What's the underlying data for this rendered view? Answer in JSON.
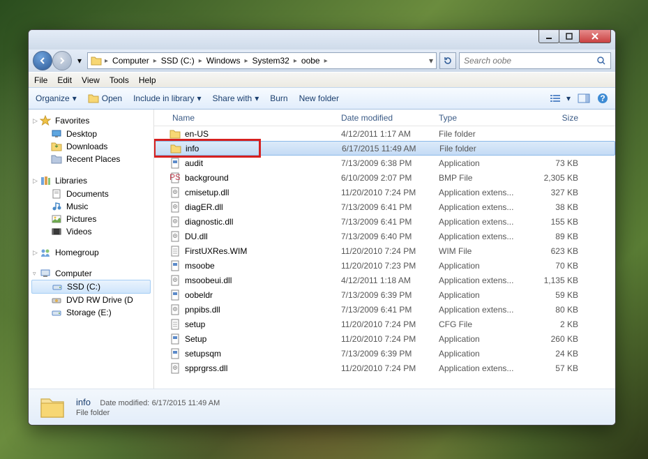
{
  "breadcrumbs": [
    "Computer",
    "SSD (C:)",
    "Windows",
    "System32",
    "oobe"
  ],
  "search": {
    "placeholder": "Search oobe"
  },
  "menu": {
    "file": "File",
    "edit": "Edit",
    "view": "View",
    "tools": "Tools",
    "help": "Help"
  },
  "toolbar": {
    "organize": "Organize",
    "open": "Open",
    "include": "Include in library",
    "share": "Share with",
    "burn": "Burn",
    "newfolder": "New folder"
  },
  "columns": {
    "name": "Name",
    "date": "Date modified",
    "type": "Type",
    "size": "Size"
  },
  "sidebar": {
    "favorites": {
      "label": "Favorites",
      "items": [
        "Desktop",
        "Downloads",
        "Recent Places"
      ]
    },
    "libraries": {
      "label": "Libraries",
      "items": [
        "Documents",
        "Music",
        "Pictures",
        "Videos"
      ]
    },
    "homegroup": {
      "label": "Homegroup"
    },
    "computer": {
      "label": "Computer",
      "items": [
        "SSD (C:)",
        "DVD RW Drive (D",
        "Storage (E:)"
      ]
    }
  },
  "files": [
    {
      "icon": "folder",
      "name": "en-US",
      "date": "4/12/2011 1:17 AM",
      "type": "File folder",
      "size": ""
    },
    {
      "icon": "folder",
      "name": "info",
      "date": "6/17/2015 11:49 AM",
      "type": "File folder",
      "size": "",
      "selected": true,
      "highlight": true
    },
    {
      "icon": "app",
      "name": "audit",
      "date": "7/13/2009 6:38 PM",
      "type": "Application",
      "size": "73 KB"
    },
    {
      "icon": "bmp",
      "name": "background",
      "date": "6/10/2009 2:07 PM",
      "type": "BMP File",
      "size": "2,305 KB"
    },
    {
      "icon": "dll",
      "name": "cmisetup.dll",
      "date": "11/20/2010 7:24 PM",
      "type": "Application extens...",
      "size": "327 KB"
    },
    {
      "icon": "dll",
      "name": "diagER.dll",
      "date": "7/13/2009 6:41 PM",
      "type": "Application extens...",
      "size": "38 KB"
    },
    {
      "icon": "dll",
      "name": "diagnostic.dll",
      "date": "7/13/2009 6:41 PM",
      "type": "Application extens...",
      "size": "155 KB"
    },
    {
      "icon": "dll",
      "name": "DU.dll",
      "date": "7/13/2009 6:40 PM",
      "type": "Application extens...",
      "size": "89 KB"
    },
    {
      "icon": "wim",
      "name": "FirstUXRes.WIM",
      "date": "11/20/2010 7:24 PM",
      "type": "WIM File",
      "size": "623 KB"
    },
    {
      "icon": "app",
      "name": "msoobe",
      "date": "11/20/2010 7:23 PM",
      "type": "Application",
      "size": "70 KB"
    },
    {
      "icon": "dll",
      "name": "msoobeui.dll",
      "date": "4/12/2011 1:18 AM",
      "type": "Application extens...",
      "size": "1,135 KB"
    },
    {
      "icon": "app",
      "name": "oobeldr",
      "date": "7/13/2009 6:39 PM",
      "type": "Application",
      "size": "59 KB"
    },
    {
      "icon": "dll",
      "name": "pnpibs.dll",
      "date": "7/13/2009 6:41 PM",
      "type": "Application extens...",
      "size": "80 KB"
    },
    {
      "icon": "cfg",
      "name": "setup",
      "date": "11/20/2010 7:24 PM",
      "type": "CFG File",
      "size": "2 KB"
    },
    {
      "icon": "app",
      "name": "Setup",
      "date": "11/20/2010 7:24 PM",
      "type": "Application",
      "size": "260 KB"
    },
    {
      "icon": "app",
      "name": "setupsqm",
      "date": "7/13/2009 6:39 PM",
      "type": "Application",
      "size": "24 KB"
    },
    {
      "icon": "dll",
      "name": "spprgrss.dll",
      "date": "11/20/2010 7:24 PM",
      "type": "Application extens...",
      "size": "57 KB"
    }
  ],
  "details": {
    "name": "info",
    "type": "File folder",
    "mod_label": "Date modified:",
    "mod": "6/17/2015 11:49 AM"
  }
}
